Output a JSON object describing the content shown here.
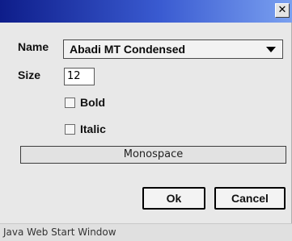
{
  "window": {
    "close_glyph": "✕",
    "status_text": "Java Web Start Window"
  },
  "form": {
    "name_label": "Name",
    "name_value": "Abadi MT Condensed",
    "size_label": "Size",
    "size_value": "12",
    "bold_label": "Bold",
    "bold_checked": false,
    "italic_label": "Italic",
    "italic_checked": false
  },
  "preview": {
    "text": "Monospace"
  },
  "buttons": {
    "ok_label": "Ok",
    "cancel_label": "Cancel"
  },
  "colors": {
    "titlebar_start": "#0e1d8a",
    "titlebar_end": "#7aa0f0",
    "background": "#e8e8e8"
  }
}
